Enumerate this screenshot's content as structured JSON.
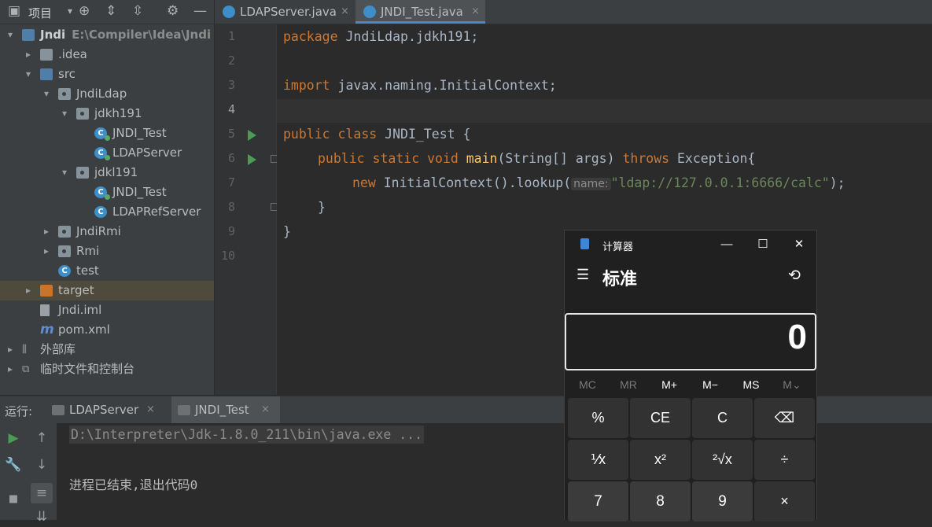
{
  "project_panel": {
    "title": "项目",
    "tree": [
      {
        "label": "Jndi",
        "path": "E:\\Compiler\\Idea\\Jndi",
        "icon": "module-folder-icon",
        "depth": 0,
        "arrow": "▾"
      },
      {
        "label": ".idea",
        "icon": "folder-icon",
        "depth": 1,
        "arrow": "▸"
      },
      {
        "label": "src",
        "icon": "source-folder-icon",
        "depth": 1,
        "arrow": "▾"
      },
      {
        "label": "JndiLdap",
        "icon": "package-icon",
        "depth": 2,
        "arrow": "▾"
      },
      {
        "label": "jdkh191",
        "icon": "package-icon",
        "depth": 3,
        "arrow": "▾"
      },
      {
        "label": "JNDI_Test",
        "icon": "java-class-icon",
        "depth": 4,
        "arrow": ""
      },
      {
        "label": "LDAPServer",
        "icon": "java-class-icon",
        "depth": 4,
        "arrow": ""
      },
      {
        "label": "jdkl191",
        "icon": "package-icon",
        "depth": 3,
        "arrow": "▾"
      },
      {
        "label": "JNDI_Test",
        "icon": "java-class-icon",
        "depth": 4,
        "arrow": ""
      },
      {
        "label": "LDAPRefServer",
        "icon": "java-class-icon",
        "depth": 4,
        "arrow": ""
      },
      {
        "label": "JndiRmi",
        "icon": "package-icon",
        "depth": 2,
        "arrow": "▸"
      },
      {
        "label": "Rmi",
        "icon": "package-icon",
        "depth": 2,
        "arrow": "▸"
      },
      {
        "label": "test",
        "icon": "java-class-icon",
        "depth": 2,
        "arrow": ""
      },
      {
        "label": "target",
        "icon": "excluded-folder-icon",
        "depth": 1,
        "arrow": "▸"
      },
      {
        "label": "Jndi.iml",
        "icon": "iml-file-icon",
        "depth": 1,
        "arrow": ""
      },
      {
        "label": "pom.xml",
        "icon": "maven-icon",
        "depth": 1,
        "arrow": ""
      },
      {
        "label": "外部库",
        "icon": "libraries-icon",
        "depth": 0,
        "arrow": "▸"
      },
      {
        "label": "临时文件和控制台",
        "icon": "scratches-icon",
        "depth": 0,
        "arrow": "▸"
      }
    ]
  },
  "editor": {
    "tabs": [
      {
        "label": "LDAPServer.java",
        "close": "×"
      },
      {
        "label": "JNDI_Test.java",
        "close": "×"
      }
    ],
    "line_numbers": [
      "1",
      "2",
      "3",
      "4",
      "5",
      "6",
      "7",
      "8",
      "9",
      "10"
    ],
    "code": {
      "l1_kw": "package",
      "l1_rest": " JndiLdap.jdkh191;",
      "l3_kw": "import",
      "l3_rest": " javax.naming.InitialContext;",
      "l5_kw": "public class",
      "l5_rest": " JNDI_Test {",
      "l6_kw1": "public static void",
      "l6_fn": "main",
      "l6_mid": "(String[] args) ",
      "l6_kw2": "throws",
      "l6_rest": " Exception{",
      "l7_kw": "new",
      "l7_mid": " InitialContext().lookup(",
      "l7_hint": "name:",
      "l7_str": "\"ldap://127.0.0.1:6666/calc\"",
      "l7_end": ");",
      "l8": "}",
      "l9": "}"
    }
  },
  "run_panel": {
    "label": "运行:",
    "tabs": [
      {
        "label": "LDAPServer",
        "close": "×"
      },
      {
        "label": "JNDI_Test",
        "close": "×"
      }
    ],
    "command": "D:\\Interpreter\\Jdk-1.8.0_211\\bin\\java.exe ...",
    "exit_message": "进程已结束,退出代码0"
  },
  "calculator": {
    "title": "计算器",
    "mode": "标准",
    "display": "0",
    "memory": [
      "MC",
      "MR",
      "M+",
      "M−",
      "MS",
      "M⌄"
    ],
    "keys": [
      "%",
      "CE",
      "C",
      "⌫",
      "⅟x",
      "x²",
      "²√x",
      "÷",
      "7",
      "8",
      "9",
      "×"
    ],
    "window_buttons": {
      "minimize": "—",
      "maximize": "☐",
      "close": "✕"
    }
  },
  "colors": {
    "keyword": "#cc7832",
    "function": "#ffc66d",
    "string": "#6a8759",
    "run_marker": "#499c54",
    "class_icon": "#3d8ec9"
  }
}
